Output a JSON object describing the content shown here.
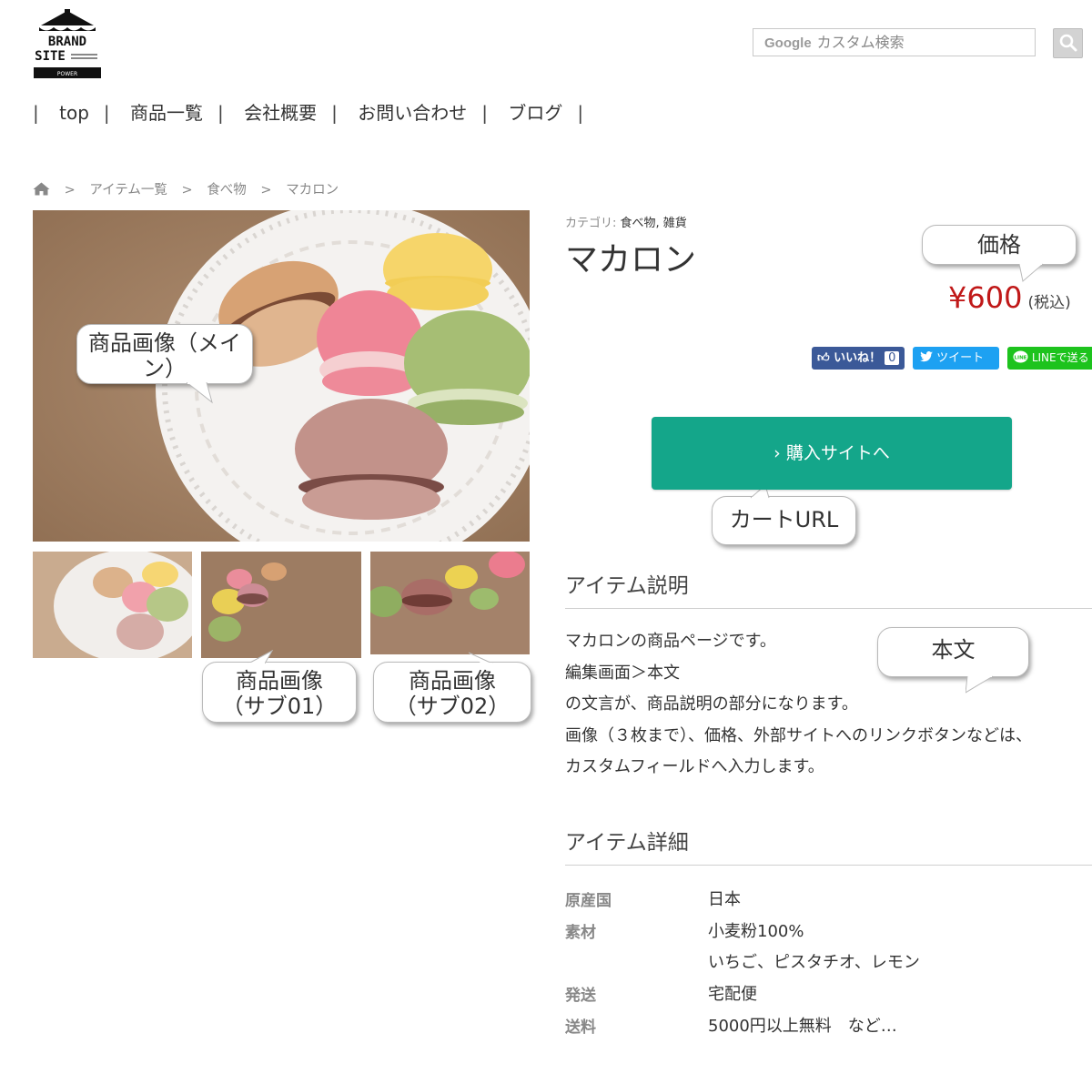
{
  "logo": {
    "line1": "BRAND",
    "line2": "SITE",
    "small": "POWER"
  },
  "search": {
    "google_mark": "Google",
    "placeholder": "カスタム検索"
  },
  "nav": {
    "items": [
      "top",
      "商品一覧",
      "会社概要",
      "お問い合わせ",
      "ブログ"
    ],
    "separator": "|"
  },
  "breadcrumb": {
    "items": [
      "アイテム一覧",
      "食べ物",
      "マカロン"
    ],
    "separator": ">"
  },
  "product": {
    "category_label": "カテゴリ:",
    "categories": "食べ物, 雑貨",
    "title": "マカロン",
    "price": "¥600",
    "tax_note": "(税込)"
  },
  "social": {
    "like_label": "いいね！",
    "like_count": "0",
    "tweet_label": "ツイート",
    "line_label": "LINEで送る"
  },
  "buy_button": {
    "label": "購入サイトへ"
  },
  "annotations": {
    "main_image": [
      "商品画像（メイ",
      "ン）"
    ],
    "sub01": [
      "商品画像",
      "（サブ01）"
    ],
    "sub02": [
      "商品画像",
      "（サブ02）"
    ],
    "price": "価格",
    "cart_url": "カートURL",
    "body": "本文"
  },
  "description": {
    "heading": "アイテム説明",
    "lines": [
      "マカロンの商品ページです。",
      "編集画面＞本文",
      "の文言が、商品説明の部分になります。",
      "画像（３枚まで）、価格、外部サイトへのリンクボタンなどは、",
      "カスタムフィールドへ入力します。"
    ]
  },
  "details": {
    "heading": "アイテム詳細",
    "rows": [
      {
        "key": "原産国",
        "values": [
          "日本"
        ]
      },
      {
        "key": "素材",
        "values": [
          "小麦粉100%",
          "いちご、ピスタチオ、レモン"
        ]
      },
      {
        "key": "発送",
        "values": [
          "宅配便"
        ]
      },
      {
        "key": "送料",
        "values": [
          "5000円以上無料　など…"
        ]
      }
    ]
  },
  "colors": {
    "buy_button": "#14a68a",
    "price": "#c01818",
    "facebook": "#3b5998",
    "twitter": "#1da1f2",
    "line": "#1dc31d"
  }
}
